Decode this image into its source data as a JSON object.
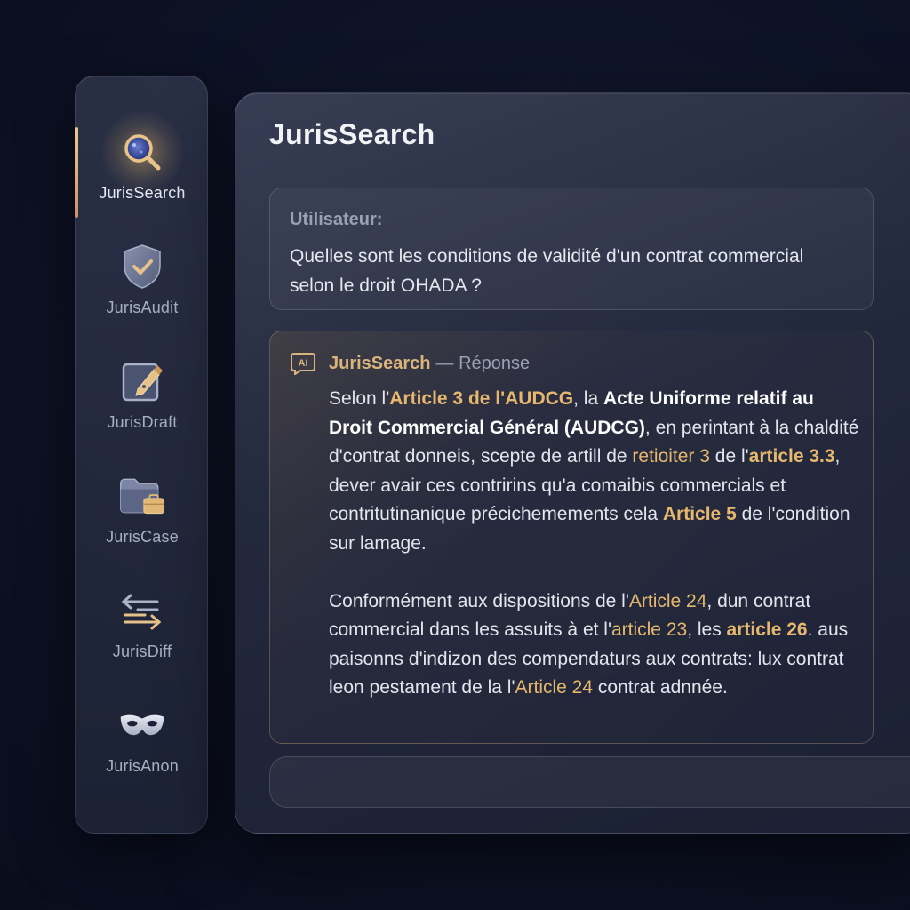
{
  "sidebar": {
    "items": [
      {
        "label": "JurisSearch",
        "icon": "search-icon",
        "active": true
      },
      {
        "label": "JurisAudit",
        "icon": "shield-check-icon",
        "active": false
      },
      {
        "label": "JurisDraft",
        "icon": "pen-document-icon",
        "active": false
      },
      {
        "label": "JurisCase",
        "icon": "folder-briefcase-icon",
        "active": false
      },
      {
        "label": "JurisDiff",
        "icon": "swap-arrows-icon",
        "active": false
      },
      {
        "label": "JurisAnon",
        "icon": "mask-icon",
        "active": false
      }
    ]
  },
  "main": {
    "title": "JurisSearch",
    "user_message": {
      "role": "Utilisateur:",
      "text": "Quelles sont les conditions de validité d'un contrat commercial selon le droit OHADA ?"
    },
    "reply": {
      "name": "JurisSearch",
      "suffix": "— Réponse",
      "icon": "ai-icon",
      "paragraph1": {
        "t1": "Selon l'",
        "r1": "Article 3 de l'AUDCG",
        "t2": ", la ",
        "s1": "Acte Uniforme relatif au Droit Commercial Général (AUDCG)",
        "t3": ", en perintant à la chaldité d'contrat donneis, scepte de artill de ",
        "r2": "retioiter 3",
        "t4": " de l'",
        "r3": "article 3.3",
        "t5": ", dever avair ces contririns qu'a comaibis commercials et contritutinanique précichemements cela ",
        "r4": "Article 5",
        "t6": " de l'condition sur lamage."
      },
      "paragraph2": {
        "t1": "Conformément aux dispositions de l'",
        "r1": "Article 24",
        "t2": ", dun contrat commercial dans les assuits à et l'",
        "r2": "article 23",
        "t3": ", les ",
        "r3": "article 26",
        "t4": ". aus paisonns d'indizon des compendaturs aux contrats: lux contrat leon pestament de la l'",
        "r4": "Article 24",
        "t5": " contrat adnnée."
      }
    },
    "composer": {
      "value": "",
      "placeholder": ""
    }
  },
  "colors": {
    "accent_gold": "#e5b86e",
    "background": "#0d1226",
    "panel": "#2a2f47"
  }
}
